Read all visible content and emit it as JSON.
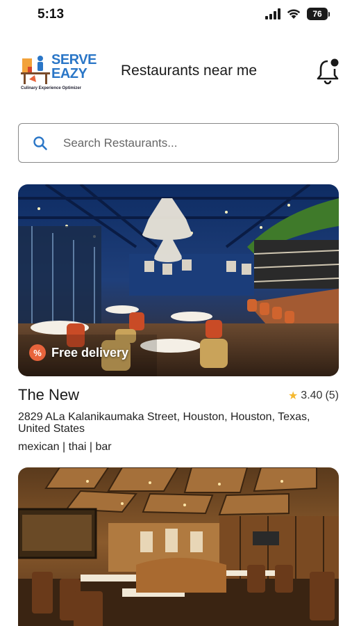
{
  "status_bar": {
    "time": "5:13",
    "battery": "76"
  },
  "header": {
    "logo_line1": "SERVE",
    "logo_line2": "EAZY",
    "logo_tagline": "Culinary Experience Optimizer",
    "title": "Restaurants near me"
  },
  "search": {
    "placeholder": "Search Restaurants..."
  },
  "restaurants": [
    {
      "name": "The New",
      "rating": "3.40",
      "reviews": "(5)",
      "address": "2829 ALa Kalanikaumaka Street, Houston, Houston, Texas, United States",
      "tags": "mexican | thai | bar",
      "badge": "Free delivery"
    },
    {
      "name": "",
      "image": "restaurant-interior-warm-wood"
    }
  ],
  "colors": {
    "brand_blue": "#2a76c7",
    "badge_orange": "#e8643c",
    "star": "#f5b82e"
  }
}
